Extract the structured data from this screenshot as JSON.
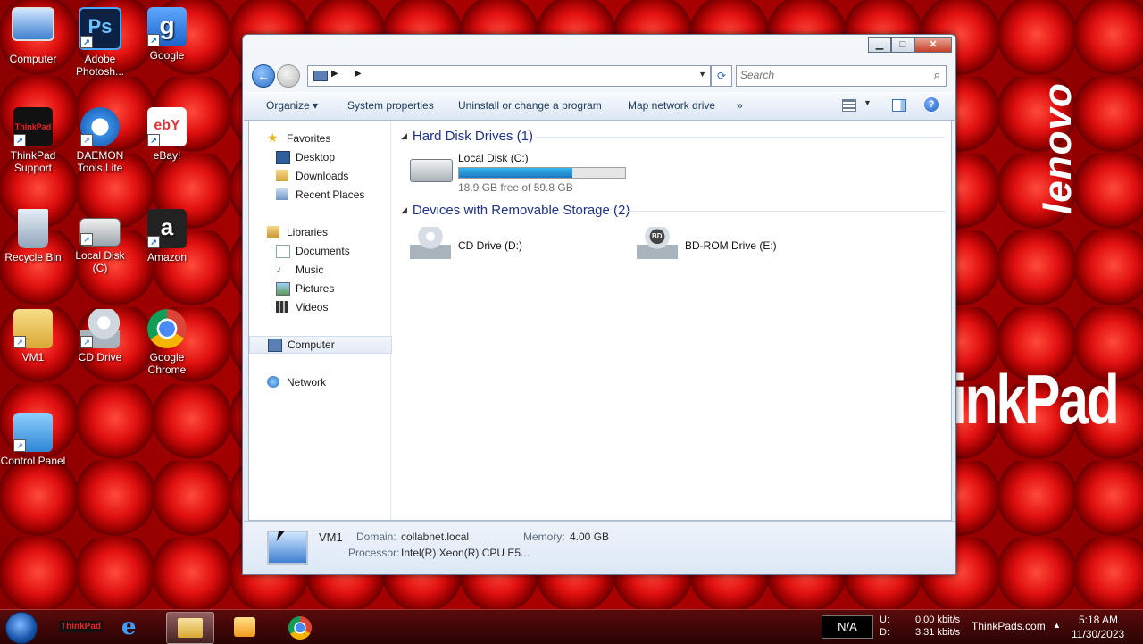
{
  "desktop": {
    "brand_text": "lenovo",
    "thinkpad_text": "inkPad",
    "icons": [
      {
        "label": "Computer",
        "icon": "computer-icon"
      },
      {
        "label": "Adobe Photosh...",
        "icon": "photoshop-icon",
        "glyph": "Ps"
      },
      {
        "label": "Google",
        "icon": "google-icon",
        "glyph": "g"
      },
      {
        "label": "ThinkPad Support",
        "icon": "thinkpad-support-icon",
        "glyph": "ThinkPad"
      },
      {
        "label": "DAEMON Tools Lite",
        "icon": "daemon-tools-icon"
      },
      {
        "label": "eBay!",
        "icon": "ebay-icon",
        "glyph": "ebY"
      },
      {
        "label": "Recycle Bin",
        "icon": "recycle-bin-icon"
      },
      {
        "label": "Local Disk (C)",
        "icon": "local-disk-icon"
      },
      {
        "label": "Amazon",
        "icon": "amazon-icon",
        "glyph": "a"
      },
      {
        "label": "VM1",
        "icon": "folder-icon"
      },
      {
        "label": "CD Drive",
        "icon": "cd-drive-icon"
      },
      {
        "label": "Google Chrome",
        "icon": "chrome-icon"
      },
      {
        "label": "Control Panel",
        "icon": "control-panel-icon"
      }
    ]
  },
  "window": {
    "controls": {
      "minimize": "▁",
      "maximize": "□",
      "close": "✕"
    },
    "search_placeholder": "Search",
    "toolbar": {
      "organize": "Organize ▾",
      "system_properties": "System properties",
      "uninstall": "Uninstall or change a program",
      "map_drive": "Map network drive",
      "more": "»",
      "help": "?"
    },
    "nav": {
      "favorites": "Favorites",
      "desktop": "Desktop",
      "downloads": "Downloads",
      "recent": "Recent Places",
      "libraries": "Libraries",
      "documents": "Documents",
      "music": "Music",
      "pictures": "Pictures",
      "videos": "Videos",
      "computer": "Computer",
      "network": "Network"
    },
    "groups": {
      "hdd_header": "Hard Disk Drives (1)",
      "removable_header": "Devices with Removable Storage (2)"
    },
    "drives": {
      "c": {
        "name": "Local Disk (C:)",
        "free": "18.9 GB free of 59.8 GB",
        "used_fraction": 0.684
      },
      "d": {
        "name": "CD Drive (D:)"
      },
      "e": {
        "name": "BD-ROM Drive (E:)",
        "badge": "BD"
      }
    },
    "details": {
      "name": "VM1",
      "domain_label": "Domain:",
      "domain": "collabnet.local",
      "memory_label": "Memory:",
      "memory": "4.00 GB",
      "processor_label": "Processor:",
      "processor": "Intel(R) Xeon(R) CPU E5..."
    }
  },
  "taskbar": {
    "thinkpad_label": "ThinkPad",
    "na": "N/A",
    "u_label": "U:",
    "d_label": "D:",
    "u_rate": "0.00 kbit/s",
    "d_rate": "3.31 kbit/s",
    "site": "ThinkPads.com",
    "tray_arrow": "▲",
    "time": "5:18 AM",
    "date": "11/30/2023"
  },
  "colors": {
    "accent": "#1e3287",
    "wallpaper": "#c40000",
    "bar_fill": "#1b78c4"
  }
}
